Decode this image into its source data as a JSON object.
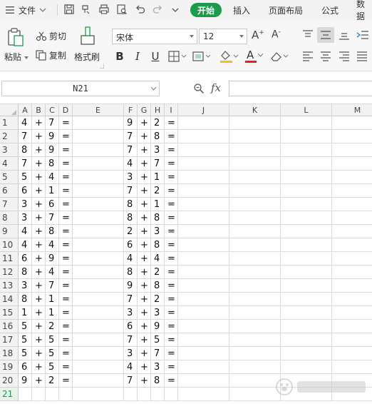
{
  "menubar": {
    "file_label": "文件",
    "tabs": [
      "开始",
      "插入",
      "页面布局",
      "公式",
      "数据"
    ]
  },
  "ribbon": {
    "paste_label": "粘贴",
    "cut_label": "剪切",
    "copy_label": "复制",
    "format_painter_label": "格式刷",
    "font_name": "宋体",
    "font_size": "12",
    "bold": "B",
    "italic": "I",
    "underline": "U",
    "font_color_letter": "A",
    "increase_font": "A",
    "decrease_font": "A",
    "accent": "#1d9a4a",
    "fill_color": "#f4c20d",
    "font_color": "#e02020"
  },
  "formula_bar": {
    "name_box": "N21",
    "fx_label": "fx",
    "formula": ""
  },
  "sheet": {
    "columns": [
      "A",
      "B",
      "C",
      "D",
      "E",
      "F",
      "G",
      "H",
      "I",
      "J",
      "K",
      "L",
      "M"
    ],
    "row_numbers": [
      "1",
      "2",
      "3",
      "4",
      "5",
      "6",
      "7",
      "8",
      "9",
      "10",
      "11",
      "12",
      "13",
      "14",
      "15",
      "16",
      "17",
      "18",
      "19",
      "20",
      "21"
    ],
    "active_row": "21",
    "rows": [
      [
        "4",
        "+",
        "7",
        "=",
        "",
        "9",
        "+",
        "2",
        "="
      ],
      [
        "7",
        "+",
        "9",
        "=",
        "",
        "7",
        "+",
        "8",
        "="
      ],
      [
        "8",
        "+",
        "9",
        "=",
        "",
        "7",
        "+",
        "3",
        "="
      ],
      [
        "7",
        "+",
        "8",
        "=",
        "",
        "4",
        "+",
        "7",
        "="
      ],
      [
        "5",
        "+",
        "4",
        "=",
        "",
        "3",
        "+",
        "1",
        "="
      ],
      [
        "6",
        "+",
        "1",
        "=",
        "",
        "7",
        "+",
        "2",
        "="
      ],
      [
        "3",
        "+",
        "6",
        "=",
        "",
        "8",
        "+",
        "1",
        "="
      ],
      [
        "3",
        "+",
        "7",
        "=",
        "",
        "8",
        "+",
        "8",
        "="
      ],
      [
        "4",
        "+",
        "8",
        "=",
        "",
        "2",
        "+",
        "3",
        "="
      ],
      [
        "4",
        "+",
        "4",
        "=",
        "",
        "6",
        "+",
        "8",
        "="
      ],
      [
        "6",
        "+",
        "9",
        "=",
        "",
        "4",
        "+",
        "4",
        "="
      ],
      [
        "8",
        "+",
        "4",
        "=",
        "",
        "8",
        "+",
        "2",
        "="
      ],
      [
        "3",
        "+",
        "7",
        "=",
        "",
        "9",
        "+",
        "8",
        "="
      ],
      [
        "8",
        "+",
        "1",
        "=",
        "",
        "7",
        "+",
        "2",
        "="
      ],
      [
        "1",
        "+",
        "1",
        "=",
        "",
        "3",
        "+",
        "3",
        "="
      ],
      [
        "5",
        "+",
        "2",
        "=",
        "",
        "6",
        "+",
        "9",
        "="
      ],
      [
        "5",
        "+",
        "5",
        "=",
        "",
        "7",
        "+",
        "5",
        "="
      ],
      [
        "5",
        "+",
        "5",
        "=",
        "",
        "3",
        "+",
        "7",
        "="
      ],
      [
        "6",
        "+",
        "5",
        "=",
        "",
        "4",
        "+",
        "3",
        "="
      ],
      [
        "9",
        "+",
        "2",
        "=",
        "",
        "7",
        "+",
        "8",
        "="
      ],
      [
        "",
        "",
        "",
        "",
        "",
        "",
        "",
        "",
        ""
      ]
    ]
  }
}
